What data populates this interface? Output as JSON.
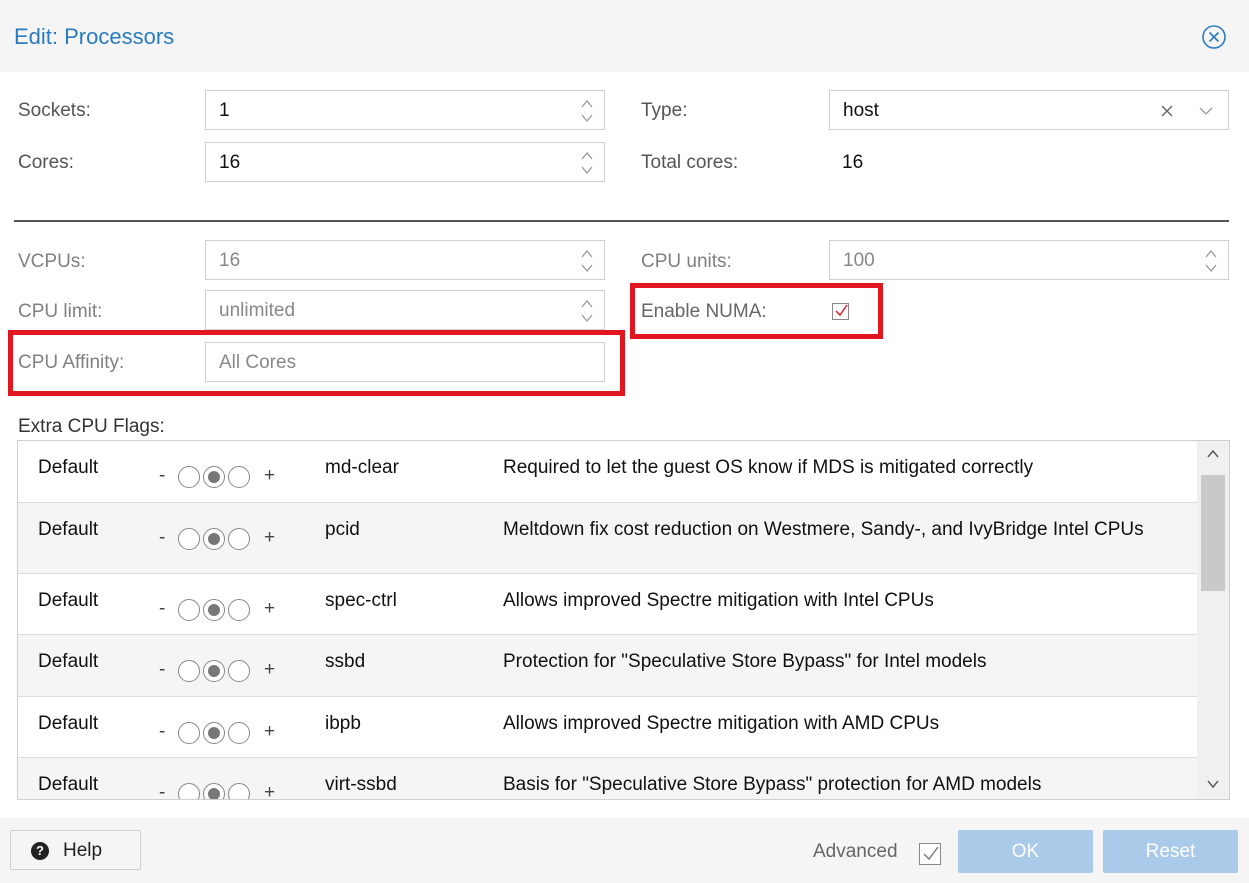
{
  "dialog": {
    "title": "Edit: Processors"
  },
  "form": {
    "sockets": {
      "label": "Sockets:",
      "value": "1"
    },
    "cores": {
      "label": "Cores:",
      "value": "16"
    },
    "type": {
      "label": "Type:",
      "value": "host"
    },
    "total_cores": {
      "label": "Total cores:",
      "value": "16"
    },
    "vcpus": {
      "label": "VCPUs:",
      "value": "16"
    },
    "cpu_units": {
      "label": "CPU units:",
      "value": "100"
    },
    "cpu_limit": {
      "label": "CPU limit:",
      "value": "unlimited"
    },
    "enable_numa": {
      "label": "Enable NUMA:",
      "checked": true
    },
    "cpu_affinity": {
      "label": "CPU Affinity:",
      "placeholder": "All Cores"
    }
  },
  "flags": {
    "label": "Extra CPU Flags:",
    "minus": "-",
    "plus": "+",
    "rows": [
      {
        "state": "Default",
        "name": "md-clear",
        "description": "Required to let the guest OS know if MDS is mitigated correctly"
      },
      {
        "state": "Default",
        "name": "pcid",
        "description": "Meltdown fix cost reduction on Westmere, Sandy-, and IvyBridge Intel CPUs"
      },
      {
        "state": "Default",
        "name": "spec-ctrl",
        "description": "Allows improved Spectre mitigation with Intel CPUs"
      },
      {
        "state": "Default",
        "name": "ssbd",
        "description": "Protection for \"Speculative Store Bypass\" for Intel models"
      },
      {
        "state": "Default",
        "name": "ibpb",
        "description": "Allows improved Spectre mitigation with AMD CPUs"
      },
      {
        "state": "Default",
        "name": "virt-ssbd",
        "description": "Basis for \"Speculative Store Bypass\" protection for AMD models"
      }
    ]
  },
  "footer": {
    "help": "Help",
    "advanced": {
      "label": "Advanced",
      "checked": true
    },
    "ok": "OK",
    "reset": "Reset"
  },
  "colors": {
    "title": "#2a7bbf",
    "highlight": "#e2161f",
    "button": "#a9cbe9",
    "check": "#e2161f"
  }
}
